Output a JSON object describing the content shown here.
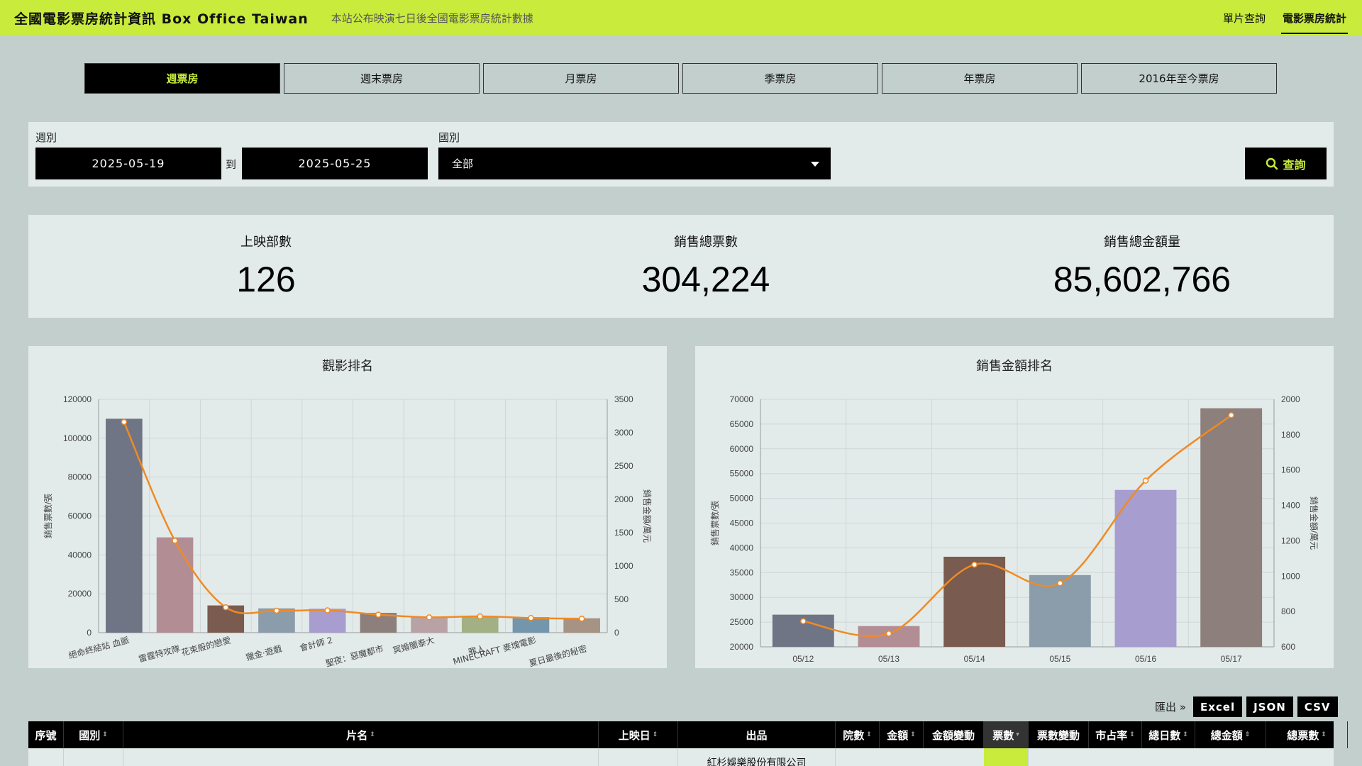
{
  "header": {
    "brand": "全國電影票房統計資訊 Box Office Taiwan",
    "tagline": "本站公布映演七日後全國電影票房統計數據",
    "nav": [
      {
        "label": "單片查詢"
      },
      {
        "label": "電影票房統計"
      }
    ]
  },
  "tabs": [
    {
      "label": "週票房"
    },
    {
      "label": "週末票房"
    },
    {
      "label": "月票房"
    },
    {
      "label": "季票房"
    },
    {
      "label": "年票房"
    },
    {
      "label": "2016年至今票房"
    }
  ],
  "filter": {
    "week_label": "週別",
    "start_date": "2025-05-19",
    "to_label": "到",
    "end_date": "2025-05-25",
    "country_label": "國別",
    "country_value": "全部",
    "search_label": "查詢"
  },
  "stats": {
    "movies_label": "上映部數",
    "movies_value": "126",
    "tickets_label": "銷售總票數",
    "tickets_value": "304,224",
    "amount_label": "銷售總金額量",
    "amount_value": "85,602,766"
  },
  "chart_data": [
    {
      "type": "bar",
      "title": "觀影排名",
      "ylabel": "銷售票數/張",
      "y2label": "銷售金額/萬元",
      "ylim": [
        0,
        120000
      ],
      "y2lim": [
        0,
        3500
      ],
      "yticks": [
        "120000",
        "100000",
        "80000",
        "60000",
        "40000",
        "20000",
        "0"
      ],
      "y2ticks": [
        "3500",
        "3000",
        "2500",
        "2000",
        "1500",
        "1000",
        "500",
        "0"
      ],
      "categories": [
        "絕命終結站 血脈",
        "雷霆特攻隊",
        "花束般的戀愛",
        "獵金·遊戲",
        "會計師 2",
        "聖夜：惡魔都市",
        "冥婚闇泰大",
        "罪人",
        "MINECRAFT 麥塊電影",
        "夏日最後的秘密"
      ],
      "series": [
        {
          "values": [
            110000,
            49000,
            14000,
            12500,
            12300,
            10200,
            8000,
            8300,
            8000,
            7400
          ]
        },
        {
          "values": [
            3160,
            1380,
            380,
            330,
            335,
            270,
            230,
            245,
            220,
            210
          ]
        }
      ],
      "colors": [
        "#6f7585",
        "#b28e94",
        "#7a5b4f",
        "#8b9cab",
        "#a79dcf",
        "#8d7f7b",
        "#b8a2a6",
        "#a2b084",
        "#7396ad",
        "#a69383"
      ],
      "line_color": "#f08a24"
    },
    {
      "type": "bar",
      "title": "銷售金額排名",
      "ylabel": "銷售票數/張",
      "y2label": "銷售金額/萬元",
      "ylim": [
        20000,
        70000
      ],
      "y2lim": [
        600,
        2000
      ],
      "yticks": [
        "70000",
        "65000",
        "60000",
        "55000",
        "50000",
        "45000",
        "40000",
        "35000",
        "30000",
        "25000",
        "20000"
      ],
      "y2ticks": [
        "2000",
        "1800",
        "1600",
        "1400",
        "1200",
        "1000",
        "800",
        "600"
      ],
      "categories": [
        "05/12",
        "05/13",
        "05/14",
        "05/15",
        "05/16",
        "05/17"
      ],
      "series": [
        {
          "values": [
            26500,
            24200,
            38200,
            34500,
            51700,
            68200
          ]
        },
        {
          "values": [
            745,
            675,
            1065,
            960,
            1540,
            1910
          ]
        }
      ],
      "colors": [
        "#6f7585",
        "#b28e94",
        "#7a5b4f",
        "#8b9cab",
        "#a79dcf",
        "#8d7f7b"
      ],
      "line_color": "#f08a24"
    }
  ],
  "export": {
    "label": "匯出 »",
    "buttons": [
      "Excel",
      "JSON",
      "CSV"
    ]
  },
  "table": {
    "columns": [
      {
        "label": "序號"
      },
      {
        "label": "國別"
      },
      {
        "label": "片名"
      },
      {
        "label": "上映日"
      },
      {
        "label": "出品"
      },
      {
        "label": "院數"
      },
      {
        "label": "金額"
      },
      {
        "label": "金額變動"
      },
      {
        "label": "票數"
      },
      {
        "label": "票數變動"
      },
      {
        "label": "市占率"
      },
      {
        "label": "總日數"
      },
      {
        "label": "總金額"
      },
      {
        "label": "總票數"
      }
    ],
    "first_row_publisher": "紅杉娛樂股份有限公司"
  }
}
